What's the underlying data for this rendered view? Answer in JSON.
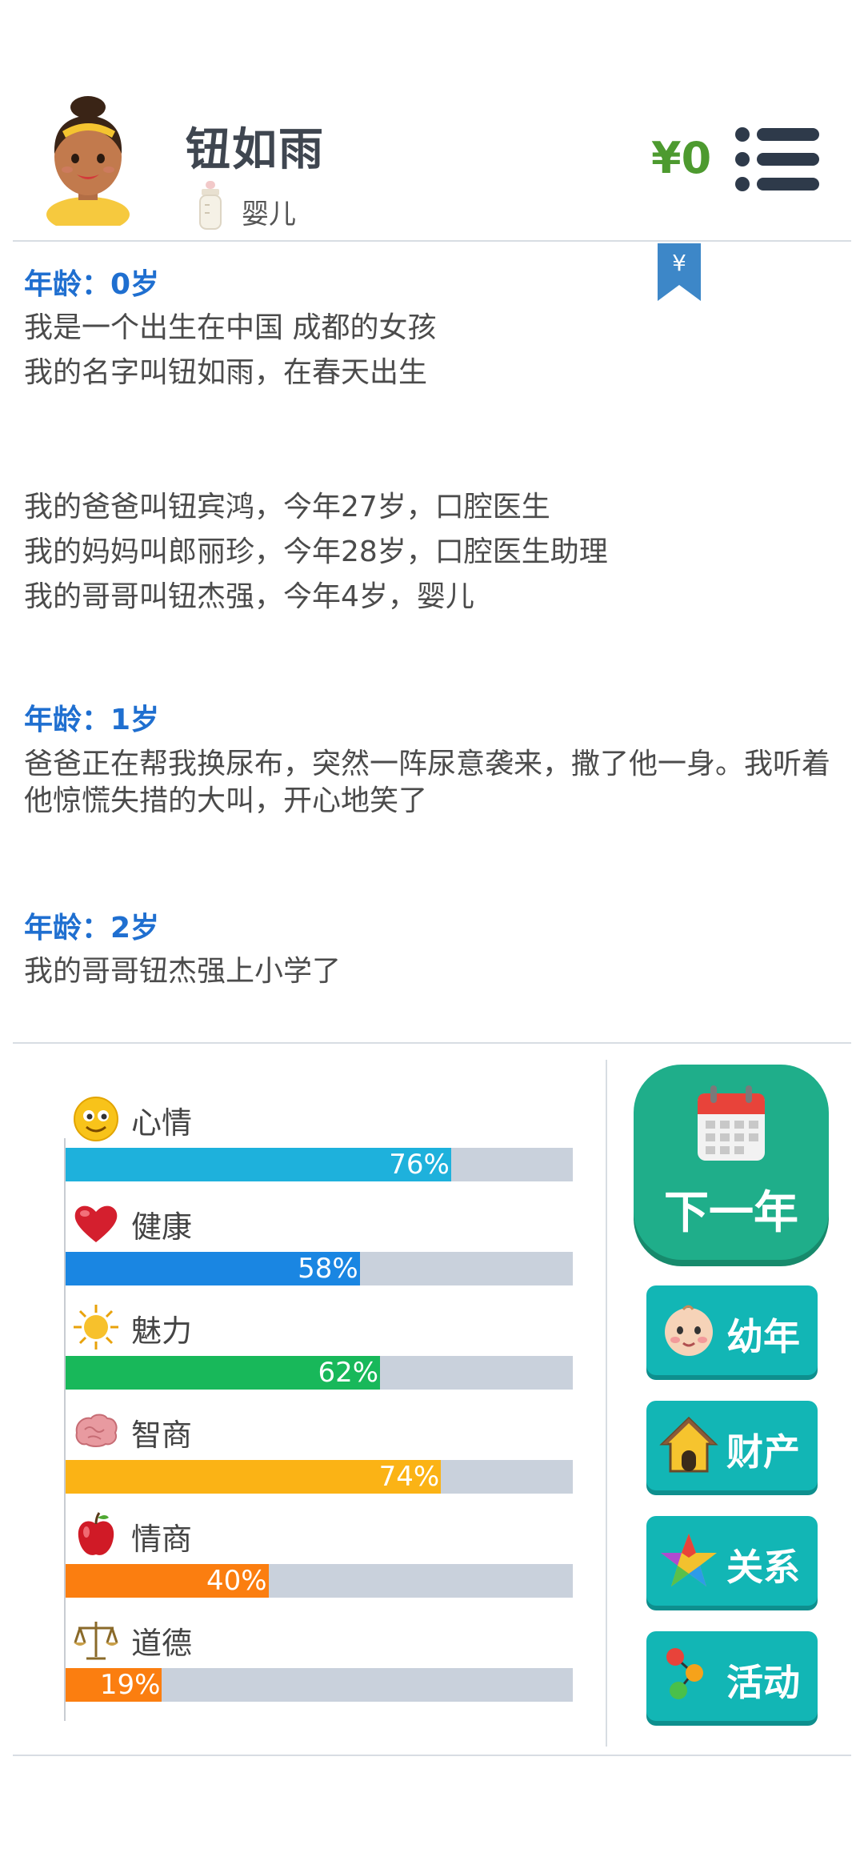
{
  "header": {
    "name": "钮如雨",
    "stage": "婴儿",
    "money": "¥0",
    "bookmark_symbol": "¥",
    "avatar_icon": "girl-avatar-icon",
    "stage_icon": "baby-bottle-icon",
    "menu_icon": "list-menu-icon"
  },
  "log": [
    {
      "age_title": "年龄：0岁",
      "lines": [
        "我是一个出生在中国 成都的女孩",
        "我的名字叫钮如雨，在春天出生"
      ]
    },
    {
      "lines": [
        "我的爸爸叫钮宾鸿，今年27岁，口腔医生",
        "我的妈妈叫郎丽珍，今年28岁，口腔医生助理",
        "我的哥哥叫钮杰强，今年4岁，婴儿"
      ]
    },
    {
      "age_title": "年龄：1岁",
      "lines": [
        "爸爸正在帮我换尿布，突然一阵尿意袭来，撒了他一身。我听着他惊慌失措的大叫，开心地笑了"
      ]
    },
    {
      "age_title": "年龄：2岁",
      "lines": [
        "我的哥哥钮杰强上小学了"
      ]
    }
  ],
  "stats": [
    {
      "label": "心情",
      "value": 76,
      "text": "76%",
      "color": "#1eb1dc",
      "icon": "smiley-icon"
    },
    {
      "label": "健康",
      "value": 58,
      "text": "58%",
      "color": "#1a86e2",
      "icon": "heart-icon"
    },
    {
      "label": "魅力",
      "value": 62,
      "text": "62%",
      "color": "#18b85a",
      "icon": "sun-icon"
    },
    {
      "label": "智商",
      "value": 74,
      "text": "74%",
      "color": "#fbb315",
      "icon": "brain-icon"
    },
    {
      "label": "情商",
      "value": 40,
      "text": "40%",
      "color": "#fb7e10",
      "icon": "apple-icon"
    },
    {
      "label": "道德",
      "value": 19,
      "text": "19%",
      "color": "#fb7e10",
      "icon": "scales-icon"
    }
  ],
  "buttons": {
    "next_year": "下一年",
    "childhood": "幼年",
    "property": "财产",
    "relations": "关系",
    "activities": "活动"
  },
  "colors": {
    "accent_blue": "#1f6fd0",
    "money_green": "#4d9a2f",
    "button_teal": "#12b6b5",
    "next_green": "#1fae8a"
  }
}
